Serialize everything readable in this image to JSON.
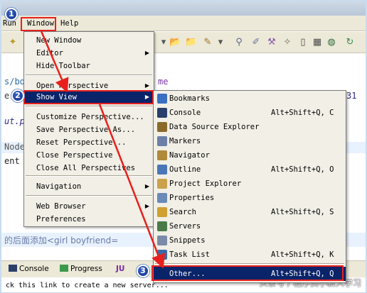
{
  "menubar": {
    "run": "Run",
    "window": "Window",
    "help": "Help"
  },
  "editor": {
    "line1": "s/bo",
    "line1b": "me",
    "line2": "e",
    "line2b": "31",
    "line3": "ut.p",
    "line4": "Node",
    "line5": "ent",
    "chinese_line": "的后面添加<girl boyfriend="
  },
  "window_menu": {
    "items": [
      {
        "label": "New Window",
        "submenu": false
      },
      {
        "label": "Editor",
        "submenu": true
      },
      {
        "label": "Hide Toolbar",
        "submenu": false
      },
      {
        "label": "Open Perspective",
        "submenu": true
      },
      {
        "label": "Show View",
        "submenu": true
      },
      {
        "label": "Customize Perspective...",
        "submenu": false
      },
      {
        "label": "Save Perspective As...",
        "submenu": false
      },
      {
        "label": "Reset Perspective...",
        "submenu": false
      },
      {
        "label": "Close Perspective",
        "submenu": false
      },
      {
        "label": "Close All Perspectives",
        "submenu": false
      },
      {
        "label": "Navigation",
        "submenu": true
      },
      {
        "label": "Web Browser",
        "submenu": true
      },
      {
        "label": "Preferences",
        "submenu": false
      }
    ]
  },
  "show_view_menu": {
    "items": [
      {
        "label": "Bookmarks",
        "shortcut": "",
        "icon": "bookmarks-icon",
        "color": "#3a6fc4"
      },
      {
        "label": "Console",
        "shortcut": "Alt+Shift+Q, C",
        "icon": "console-icon",
        "color": "#2a3f6a"
      },
      {
        "label": "Data Source Explorer",
        "shortcut": "",
        "icon": "data-source-icon",
        "color": "#8a6a2a"
      },
      {
        "label": "Markers",
        "shortcut": "",
        "icon": "markers-icon",
        "color": "#6b7fa8"
      },
      {
        "label": "Navigator",
        "shortcut": "",
        "icon": "navigator-icon",
        "color": "#b08a3a"
      },
      {
        "label": "Outline",
        "shortcut": "Alt+Shift+Q, O",
        "icon": "outline-icon",
        "color": "#4a76b8"
      },
      {
        "label": "Project Explorer",
        "shortcut": "",
        "icon": "project-explorer-icon",
        "color": "#c9a24a"
      },
      {
        "label": "Properties",
        "shortcut": "",
        "icon": "properties-icon",
        "color": "#6a8ab8"
      },
      {
        "label": "Search",
        "shortcut": "Alt+Shift+Q, S",
        "icon": "search-icon",
        "color": "#d0a030"
      },
      {
        "label": "Servers",
        "shortcut": "",
        "icon": "servers-icon",
        "color": "#4a7a4a"
      },
      {
        "label": "Snippets",
        "shortcut": "",
        "icon": "snippets-icon",
        "color": "#7a8aa8"
      },
      {
        "label": "Task List",
        "shortcut": "Alt+Shift+Q, K",
        "icon": "task-list-icon",
        "color": "#3a6aa8"
      },
      {
        "label": "Other...",
        "shortcut": "Alt+Shift+Q, Q",
        "icon": "",
        "color": ""
      }
    ]
  },
  "bottom_tabs": {
    "console": "Console",
    "progress": "Progress",
    "junit": "JU",
    "link_text": "ck this link to create a new server..."
  },
  "annotations": {
    "step1": "1",
    "step2": "2",
    "step3": "3"
  },
  "watermark": "头条号 / 程序员小新人学习",
  "colors": {
    "selection": "#0a246a",
    "annotation_red": "#e8201c",
    "badge_blue": "#1e4aa8"
  }
}
